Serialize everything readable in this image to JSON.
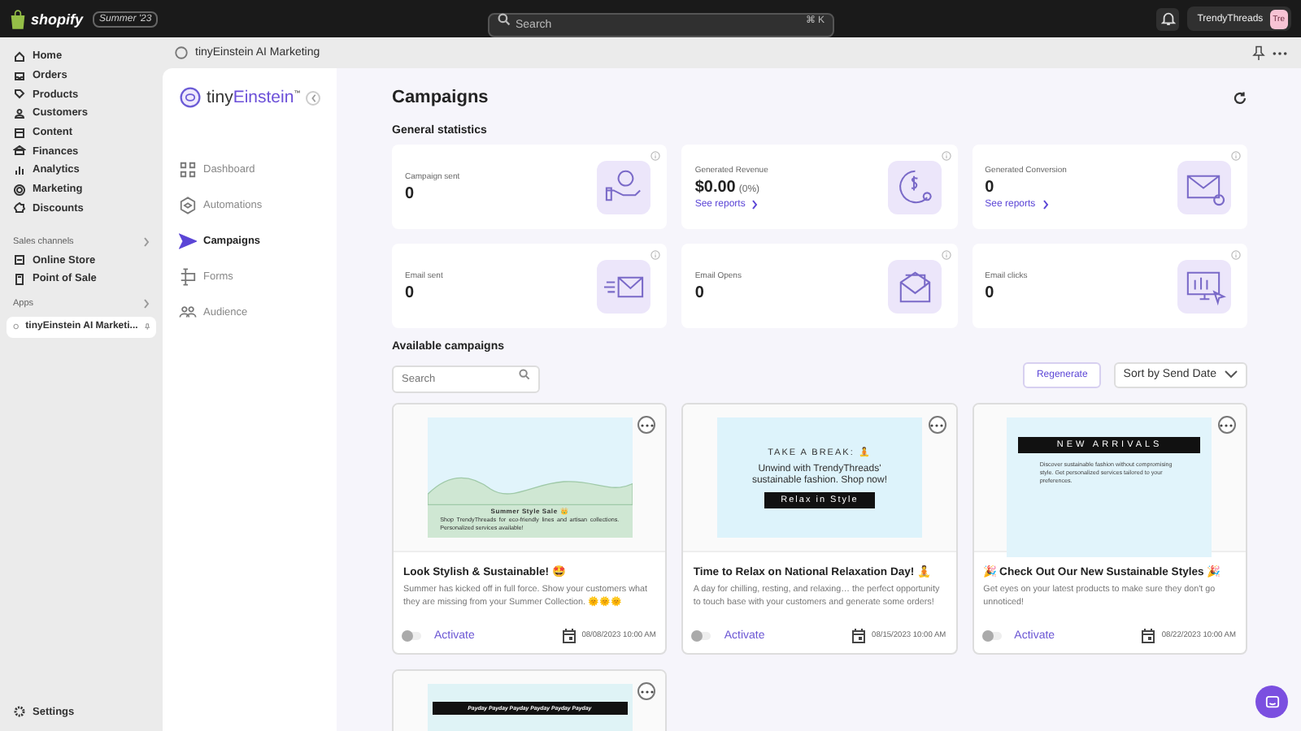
{
  "topbar": {
    "brand": "shopify",
    "edition": "Summer '23",
    "search": {
      "placeholder": "Search"
    },
    "shortcut": "⌘ K",
    "store": "TrendyThreads",
    "avatar": "Tre"
  },
  "nav": {
    "items": [
      {
        "label": "Home"
      },
      {
        "label": "Orders"
      },
      {
        "label": "Products"
      },
      {
        "label": "Customers"
      },
      {
        "label": "Content"
      },
      {
        "label": "Finances"
      },
      {
        "label": "Analytics"
      },
      {
        "label": "Marketing"
      },
      {
        "label": "Discounts"
      }
    ],
    "sales_heading": "Sales channels",
    "sales": [
      {
        "label": "Online Store"
      },
      {
        "label": "Point of Sale"
      }
    ],
    "apps_heading": "Apps",
    "apps": [
      {
        "label": "tinyEinstein AI Marketi...",
        "selected": true
      }
    ],
    "settings": "Settings"
  },
  "breadcrumb": "tinyEinstein AI Marketing",
  "app_sidebar": {
    "logo_plain": "tiny",
    "logo_accent": "Einstein",
    "logo_mark": "™",
    "items": [
      {
        "label": "Dashboard",
        "selected": false
      },
      {
        "label": "Automations",
        "selected": false
      },
      {
        "label": "Campaigns",
        "selected": true
      },
      {
        "label": "Forms",
        "selected": false
      },
      {
        "label": "Audience",
        "selected": false
      }
    ]
  },
  "title": "Campaigns",
  "stats_heading": "General statistics",
  "stats": [
    {
      "label": "Campaign sent",
      "value": "0"
    },
    {
      "label": "Generated Revenue",
      "value": "$0.00",
      "note": "(0%)",
      "link": "See reports"
    },
    {
      "label": "Generated Conversion",
      "value": "0",
      "link": "See reports"
    },
    {
      "label": "Email sent",
      "value": "0"
    },
    {
      "label": "Email Opens",
      "value": "0"
    },
    {
      "label": "Email clicks",
      "value": "0"
    }
  ],
  "campaigns_heading": "Available campaigns",
  "campaign_search": {
    "placeholder": "Search"
  },
  "regenerate": "Regenerate",
  "sort": "Sort by Send Date",
  "campaigns": [
    {
      "kind": "summer",
      "preview": [
        "Summer Style Sale 👑",
        "Shop TrendyThreads for eco-friendly lines and artisan collections. Personalized services available!"
      ],
      "title": "Look Stylish & Sustainable! 🤩",
      "body": "Summer has kicked off in full force. Show your customers what they are missing from your Summer Collection. 🌞🌞🌞",
      "activate": "Activate",
      "on": false,
      "date": "08/08/2023 10:00 AM"
    },
    {
      "kind": "relax",
      "preview": [
        "TAKE A BREAK: 🧘",
        "Unwind with TrendyThreads' sustainable fashion. Shop now!",
        "Relax in Style"
      ],
      "title": "Time to Relax on National Relaxation Day! 🧘",
      "body": "A day for chilling, resting, and relaxing… the perfect opportunity to touch base with your customers and generate some orders!",
      "activate": "Activate",
      "on": false,
      "date": "08/15/2023 10:00 AM"
    },
    {
      "kind": "arrivals",
      "preview": [
        "NEW ARRIVALS",
        "Discover sustainable fashion without compromising style. Get personalized services tailored to your preferences."
      ],
      "title": "🎉 Check Out Our New Sustainable Styles 🎉",
      "body": "Get eyes on your latest products to make sure they don't go unnoticed!",
      "activate": "Activate",
      "on": false,
      "date": "08/22/2023 10:00 AM"
    },
    {
      "kind": "payday",
      "preview": [
        "Payday Payday Payday Payday Payday Payday"
      ]
    }
  ]
}
